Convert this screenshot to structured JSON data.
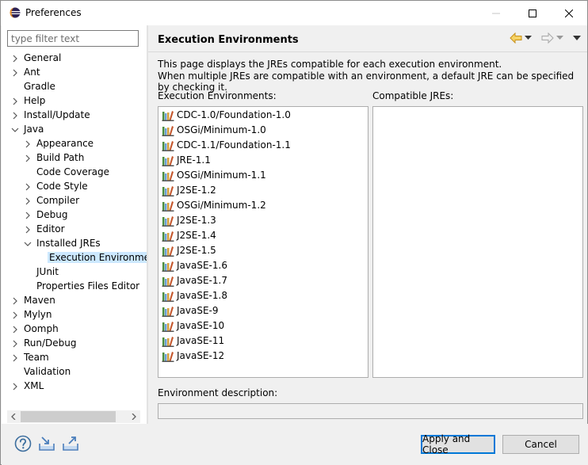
{
  "window": {
    "title": "Preferences"
  },
  "filter": {
    "placeholder": "type filter text"
  },
  "tree": [
    {
      "label": "General",
      "level": 0,
      "expander": "collapsed"
    },
    {
      "label": "Ant",
      "level": 0,
      "expander": "collapsed"
    },
    {
      "label": "Gradle",
      "level": 0,
      "expander": "none"
    },
    {
      "label": "Help",
      "level": 0,
      "expander": "collapsed"
    },
    {
      "label": "Install/Update",
      "level": 0,
      "expander": "collapsed"
    },
    {
      "label": "Java",
      "level": 0,
      "expander": "expanded"
    },
    {
      "label": "Appearance",
      "level": 1,
      "expander": "collapsed"
    },
    {
      "label": "Build Path",
      "level": 1,
      "expander": "collapsed"
    },
    {
      "label": "Code Coverage",
      "level": 1,
      "expander": "none"
    },
    {
      "label": "Code Style",
      "level": 1,
      "expander": "collapsed"
    },
    {
      "label": "Compiler",
      "level": 1,
      "expander": "collapsed"
    },
    {
      "label": "Debug",
      "level": 1,
      "expander": "collapsed"
    },
    {
      "label": "Editor",
      "level": 1,
      "expander": "collapsed"
    },
    {
      "label": "Installed JREs",
      "level": 1,
      "expander": "expanded"
    },
    {
      "label": "Execution Environmen",
      "level": 2,
      "expander": "none",
      "selected": true
    },
    {
      "label": "JUnit",
      "level": 1,
      "expander": "none"
    },
    {
      "label": "Properties Files Editor",
      "level": 1,
      "expander": "none"
    },
    {
      "label": "Maven",
      "level": 0,
      "expander": "collapsed"
    },
    {
      "label": "Mylyn",
      "level": 0,
      "expander": "collapsed"
    },
    {
      "label": "Oomph",
      "level": 0,
      "expander": "collapsed"
    },
    {
      "label": "Run/Debug",
      "level": 0,
      "expander": "collapsed"
    },
    {
      "label": "Team",
      "level": 0,
      "expander": "collapsed"
    },
    {
      "label": "Validation",
      "level": 0,
      "expander": "none"
    },
    {
      "label": "XML",
      "level": 0,
      "expander": "collapsed"
    }
  ],
  "page": {
    "title": "Execution Environments",
    "description_line1": "This page displays the JREs compatible for each execution environment.",
    "description_line2": "When multiple JREs are compatible with an environment, a default JRE can be specified by checking it.",
    "env_label": "Execution Environments:",
    "jre_label": "Compatible JREs:",
    "env_desc_label": "Environment description:",
    "environments": [
      "CDC-1.0/Foundation-1.0",
      "OSGi/Minimum-1.0",
      "CDC-1.1/Foundation-1.1",
      "JRE-1.1",
      "OSGi/Minimum-1.1",
      "J2SE-1.2",
      "OSGi/Minimum-1.2",
      "J2SE-1.3",
      "J2SE-1.4",
      "J2SE-1.5",
      "JavaSE-1.6",
      "JavaSE-1.7",
      "JavaSE-1.8",
      "JavaSE-9",
      "JavaSE-10",
      "JavaSE-11",
      "JavaSE-12"
    ]
  },
  "buttons": {
    "apply_close": "Apply and Close",
    "cancel": "Cancel"
  },
  "icons": {
    "app": "eclipse-icon",
    "help": "help-icon",
    "import": "import-icon",
    "export": "export-icon",
    "back": "back-arrow-icon",
    "forward": "forward-arrow-icon",
    "menu": "view-menu-icon",
    "environment": "java-library-icon"
  },
  "colors": {
    "accent": "#0078d7",
    "selection": "#cce8ff",
    "nav_arrow": "#e8a317"
  }
}
